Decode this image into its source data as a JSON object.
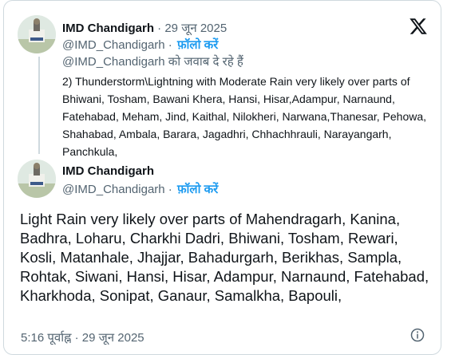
{
  "reply_tweet": {
    "author_name": "IMD Chandigarh",
    "separator": "·",
    "date": "29 जून 2025",
    "handle": "@IMD_Chandigarh",
    "follow_label": "फ़ॉलो करें",
    "reply_note": "@IMD_Chandigarh को जवाब दे रहे हैं",
    "text": "2) Thunderstorm\\Lightning with Moderate Rain very likely over parts of Bhiwani, Tosham, Bawani Khera, Hansi, Hisar,Adampur, Narnaund, Fatehabad, Meham, Jind, Kaithal, Nilokheri, Narwana,Thanesar, Pehowa, Shahabad, Ambala, Barara, Jagadhri, Chhachhrauli, Narayangarh, Panchkula,"
  },
  "main_tweet": {
    "author_name": "IMD Chandigarh",
    "handle": "@IMD_Chandigarh",
    "follow_label": "फ़ॉलो करें",
    "text": "Light Rain very likely over parts of Mahendragarh, Kanina, Badhra, Loharu, Charkhi Dadri, Bhiwani, Tosham, Rewari, Kosli, Matanhale, Jhajjar, Bahadurgarh, Berikhas, Sampla, Rohtak, Siwani, Hansi, Hisar, Adampur, Narnaund, Fatehabad,\nKharkhoda, Sonipat, Ganaur, Samalkha, Bapouli,",
    "time": "5:16 पूर्वाह्न",
    "date": "29 जून 2025"
  },
  "icons": {
    "platform_logo": "x-logo-icon",
    "info": "info-icon",
    "avatar": "imd-emblem-avatar"
  },
  "colors": {
    "link": "#1d9bf0",
    "secondary_text": "#536471",
    "primary_text": "#0f1419",
    "border": "#cfd9de"
  }
}
